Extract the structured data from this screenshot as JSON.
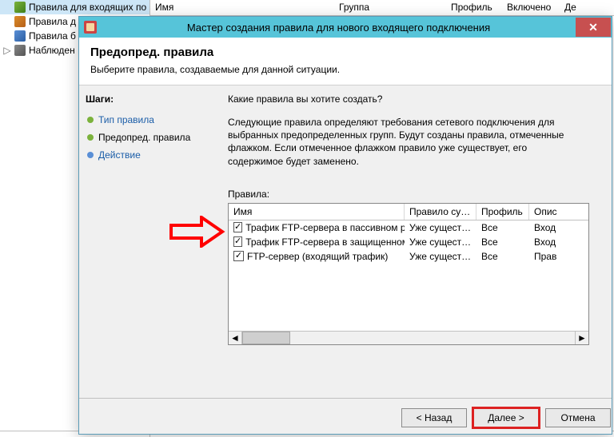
{
  "bg": {
    "tree": [
      {
        "label": "Правила для входящих по",
        "icon": "inbound",
        "selected": true
      },
      {
        "label": "Правила д",
        "icon": "outbound",
        "selected": false
      },
      {
        "label": "Правила б",
        "icon": "sec",
        "selected": false
      },
      {
        "label": "Наблюден",
        "icon": "mon",
        "selected": false,
        "expandable": true
      }
    ],
    "columns": {
      "name": "Имя",
      "group": "Группа",
      "profile": "Профиль",
      "enabled": "Включено",
      "action": "Де"
    }
  },
  "wizard": {
    "title": "Мастер создания правила для нового входящего подключения",
    "header": {
      "heading": "Предопред. правила",
      "sub": "Выберите правила, создаваемые для данной ситуации."
    },
    "steps_title": "Шаги:",
    "steps": [
      {
        "label": "Тип правила",
        "state": "done"
      },
      {
        "label": "Предопред. правила",
        "state": "current"
      },
      {
        "label": "Действие",
        "state": "future"
      }
    ],
    "question": "Какие правила вы хотите создать?",
    "description": "Следующие правила определяют требования сетевого подключения для выбранных предопределенных групп. Будут созданы правила, отмеченные флажком. Если отмеченное флажком правило уже существует, его содержимое будет заменено.",
    "rules_label": "Правила:",
    "rules_headers": {
      "name": "Имя",
      "exists": "Правило сущ...",
      "profile": "Профиль",
      "desc": "Опис"
    },
    "rules": [
      {
        "checked": true,
        "name": "Трафик FTP-сервера в пассивном режим...",
        "exists": "Уже существ...",
        "profile": "Все",
        "desc": "Вход"
      },
      {
        "checked": true,
        "name": "Трафик FTP-сервера в защищенном режи...",
        "exists": "Уже существ...",
        "profile": "Все",
        "desc": "Вход"
      },
      {
        "checked": true,
        "name": "FTP-сервер (входящий трафик)",
        "exists": "Уже существ...",
        "profile": "Все",
        "desc": "Прав"
      }
    ],
    "buttons": {
      "back": "< Назад",
      "next": "Далее >",
      "cancel": "Отмена"
    }
  }
}
